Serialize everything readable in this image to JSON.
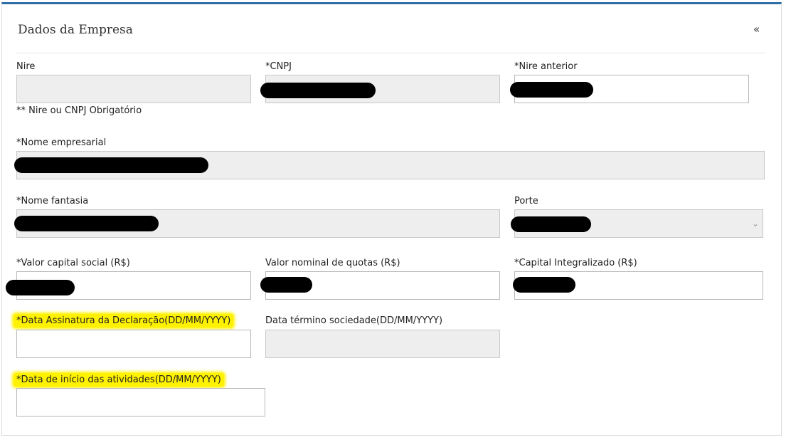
{
  "panel": {
    "title": "Dados da Empresa",
    "collapse_icon": "«"
  },
  "fields": {
    "nire": {
      "label": "Nire",
      "value": ""
    },
    "cnpj": {
      "label": "*CNPJ",
      "value": ""
    },
    "nire_anterior": {
      "label": "*Nire anterior",
      "value": ""
    },
    "nire_cnpj_note": "** Nire ou CNPJ Obrigatório",
    "nome_empresarial": {
      "label": "*Nome empresarial",
      "value": ""
    },
    "nome_fantasia": {
      "label": "*Nome fantasia",
      "value": ""
    },
    "porte": {
      "label": "Porte",
      "value": ""
    },
    "valor_capital_social": {
      "label": "*Valor capital social (R$)",
      "value": ""
    },
    "valor_nominal_quotas": {
      "label": "Valor nominal de quotas (R$)",
      "value": ""
    },
    "capital_integralizado": {
      "label": "*Capital Integralizado (R$)",
      "value": ""
    },
    "data_assinatura": {
      "label": "*Data Assinatura da Declaração(DD/MM/YYYY)",
      "value": ""
    },
    "data_termino": {
      "label": "Data término sociedade(DD/MM/YYYY)",
      "value": ""
    },
    "data_inicio": {
      "label": "*Data de início das atividades(DD/MM/YYYY)",
      "value": ""
    }
  },
  "icons": {
    "collapse": "double-chevron-left-icon",
    "select_arrow": "chevron-down-icon"
  },
  "colors": {
    "accent_border": "#2f6ea7",
    "highlight": "#fff200",
    "disabled_bg": "#eeeeee"
  }
}
